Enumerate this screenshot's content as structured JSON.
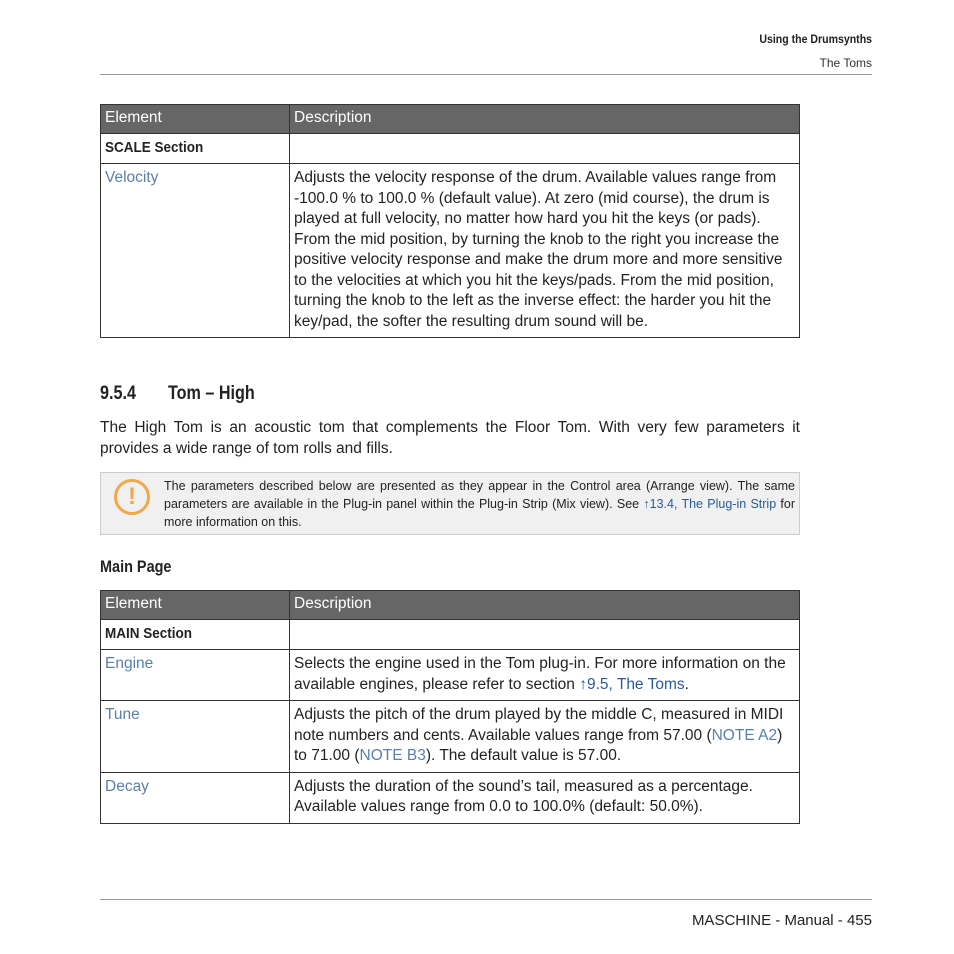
{
  "header": {
    "chapter": "Using the Drumsynths",
    "section": "The Toms"
  },
  "table1": {
    "headers": [
      "Element",
      "Description"
    ],
    "section_row": "SCALE Section",
    "rows": [
      {
        "element": "Velocity",
        "description": "Adjusts the velocity response of the drum. Available values range from -100.0 % to 100.0 % (default value). At zero (mid course), the drum is played at full velocity, no matter how hard you hit the keys (or pads). From the mid position, by turning the knob to the right you increase the positive velocity response and make the drum more and more sensitive to the velocities at which you hit the keys/pads. From the mid position, turning the knob to the left as the inverse effect: the harder you hit the key/pad, the softer the resulting drum sound will be."
      }
    ]
  },
  "section_heading": {
    "number": "9.5.4",
    "title": "Tom – High"
  },
  "intro": "The High Tom is an acoustic tom that complements the Floor Tom. With very few parameters it provides a wide range of tom rolls and fills.",
  "note": {
    "icon": "exclamation-icon",
    "text_before": "The parameters described below are presented as they appear in the Control area (Arrange view). The same parameters are available in the Plug-in panel within the Plug-in Strip (Mix view). See ",
    "link": "↑13.4, The Plug-in Strip",
    "text_after": " for more information on this."
  },
  "subheading": "Main Page",
  "table2": {
    "headers": [
      "Element",
      "Description"
    ],
    "section_row": "MAIN Section",
    "rows": [
      {
        "element": "Engine",
        "d1": "Selects the engine used in the Tom plug-in. For more information on the available engines, please refer to section ",
        "link": "↑9.5, The Toms",
        "d2": "."
      },
      {
        "element": "Tune",
        "d1": "Adjusts the pitch of the drum played by the middle C, measured in MIDI note numbers and cents. Available values range from 57.00 (",
        "link1": "NOTE A2",
        "d2": ") to 71.00 (",
        "link2": "NOTE B3",
        "d3": "). The default value is 57.00."
      },
      {
        "element": "Decay",
        "d1": "Adjusts the duration of the sound’s tail, measured as a percentage. Available values range from 0.0 to 100.0% (default: 50.0%)."
      }
    ]
  },
  "footer": "MASCHINE - Manual - 455"
}
